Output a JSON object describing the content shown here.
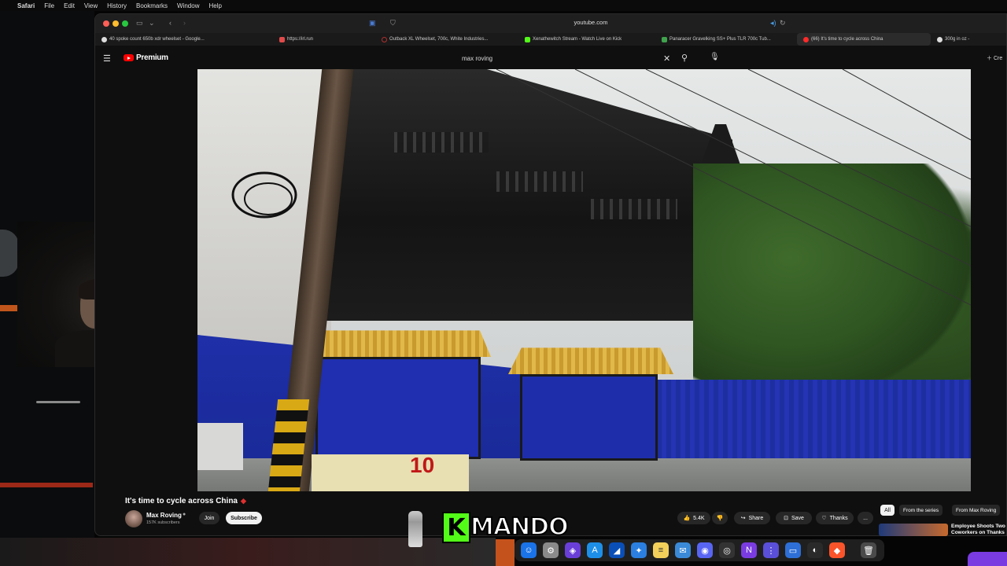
{
  "menubar": {
    "app": "Safari",
    "items": [
      "File",
      "Edit",
      "View",
      "History",
      "Bookmarks",
      "Window",
      "Help"
    ]
  },
  "browser": {
    "address": "youtube.com",
    "tabs": [
      {
        "label": "40 spoke count 650b xdr wheelset - Google...",
        "color": "#dddddd"
      },
      {
        "label": "https://irl.run",
        "color": "#e04a4a"
      },
      {
        "label": "Outback XL Wheelset, 700c, White Industries...",
        "color": "#b03030"
      },
      {
        "label": "Xenathewitch Stream - Watch Live on Kick",
        "color": "#53fc18"
      },
      {
        "label": "Panaracer Gravelking SS+ Plus TLR 700c Tub...",
        "color": "#3fa34d"
      },
      {
        "label": "(66) It's time to cycle across China",
        "color": "#ff2a2a",
        "active": true
      },
      {
        "label": "300g in oz -",
        "color": "#dddddd"
      }
    ]
  },
  "youtube": {
    "logo_text": "Premium",
    "search_value": "max roving",
    "create_label": "Cre"
  },
  "video": {
    "title": "It's time to cycle across China",
    "sign_number": "10"
  },
  "channel": {
    "name": "Max Roving",
    "subscribers": "157K subscribers",
    "join_label": "Join",
    "subscribe_label": "Subscribe"
  },
  "actions": {
    "likes": "5.4K",
    "share": "Share",
    "save": "Save",
    "thanks": "Thanks",
    "more": "..."
  },
  "sidebar": {
    "chips": [
      "All",
      "From the series",
      "From Max Roving"
    ],
    "rec_title": "Employee Shoots Two Coworkers on Thanks"
  },
  "overlay": {
    "kick_letter": "K",
    "kick_name": "MANDO"
  }
}
